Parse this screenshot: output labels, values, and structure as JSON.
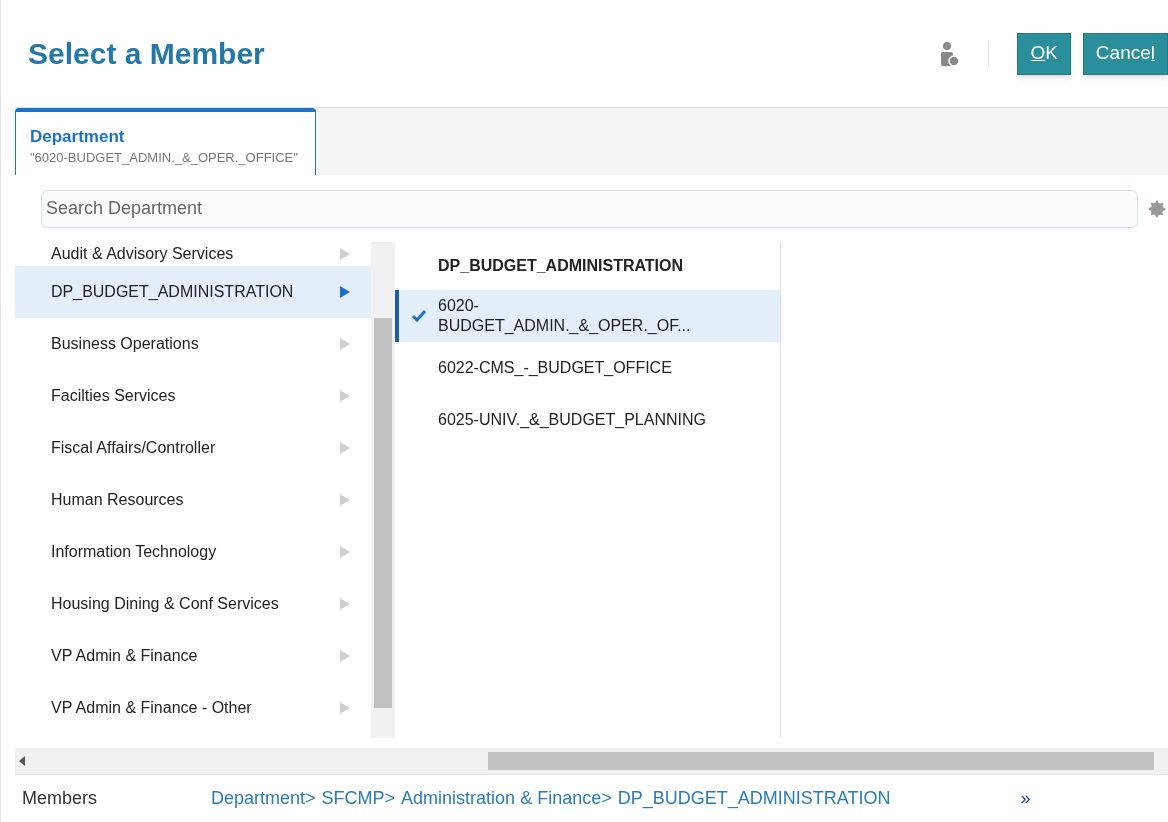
{
  "dialog": {
    "title": "Select a Member"
  },
  "buttons": [
    {
      "access_key": "O",
      "after": "K"
    },
    {
      "before": "Cance",
      "access_key": "l"
    }
  ],
  "tabs": [
    {
      "label": "Department",
      "value": "\"6020-BUDGET_ADMIN._&_OPER._OFFICE\"",
      "selected": true
    }
  ],
  "search": {
    "placeholder": "Search Department"
  },
  "left_list": [
    {
      "label": "Audit & Advisory Services",
      "selected": false
    },
    {
      "label": "DP_BUDGET_ADMINISTRATION",
      "selected": true
    },
    {
      "label": "Business Operations",
      "selected": false
    },
    {
      "label": "Facilties Services",
      "selected": false
    },
    {
      "label": "Fiscal Affairs/Controller",
      "selected": false
    },
    {
      "label": "Human Resources",
      "selected": false
    },
    {
      "label": "Information Technology",
      "selected": false
    },
    {
      "label": "Housing Dining & Conf Services",
      "selected": false
    },
    {
      "label": "VP Admin & Finance",
      "selected": false
    },
    {
      "label": "VP Admin & Finance - Other",
      "selected": false
    }
  ],
  "middle_list": {
    "header": "DP_BUDGET_ADMINISTRATION",
    "items": [
      {
        "label": "6020-\nBUDGET_ADMIN._&_OPER._OF...",
        "checked": true
      },
      {
        "label": "6022-CMS_-_BUDGET_OFFICE",
        "checked": false
      },
      {
        "label": "6025-UNIV._&_BUDGET_PLANNING",
        "checked": false
      }
    ]
  },
  "footer": {
    "label": "Members",
    "breadcrumb": [
      "Department>",
      "SFCMP>",
      "Administration & Finance>",
      "DP_BUDGET_ADMINISTRATION"
    ],
    "more": "»"
  }
}
